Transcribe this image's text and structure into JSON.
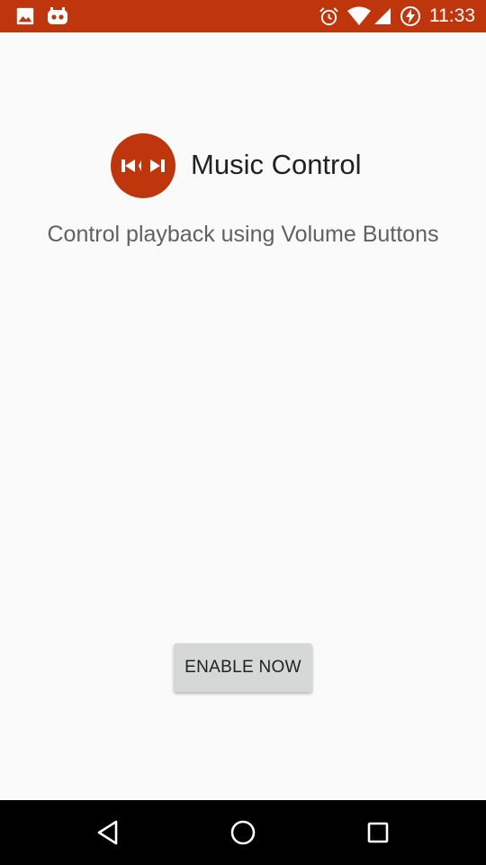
{
  "status_bar": {
    "time": "11:33",
    "background": "#bf360c",
    "left_icons": [
      "image-icon",
      "cyanogen-icon"
    ],
    "right_icons": [
      "alarm-icon",
      "wifi-icon",
      "signal-icon",
      "battery-charging-icon"
    ]
  },
  "app": {
    "title": "Music Control",
    "subtitle": "Control playback using Volume Buttons",
    "accent_color": "#bf360c",
    "logo_icon": "skip-prev-next-icon"
  },
  "actions": {
    "enable_label": "ENABLE NOW"
  },
  "nav_bar": {
    "buttons": [
      "back-icon",
      "home-icon",
      "recents-icon"
    ]
  }
}
